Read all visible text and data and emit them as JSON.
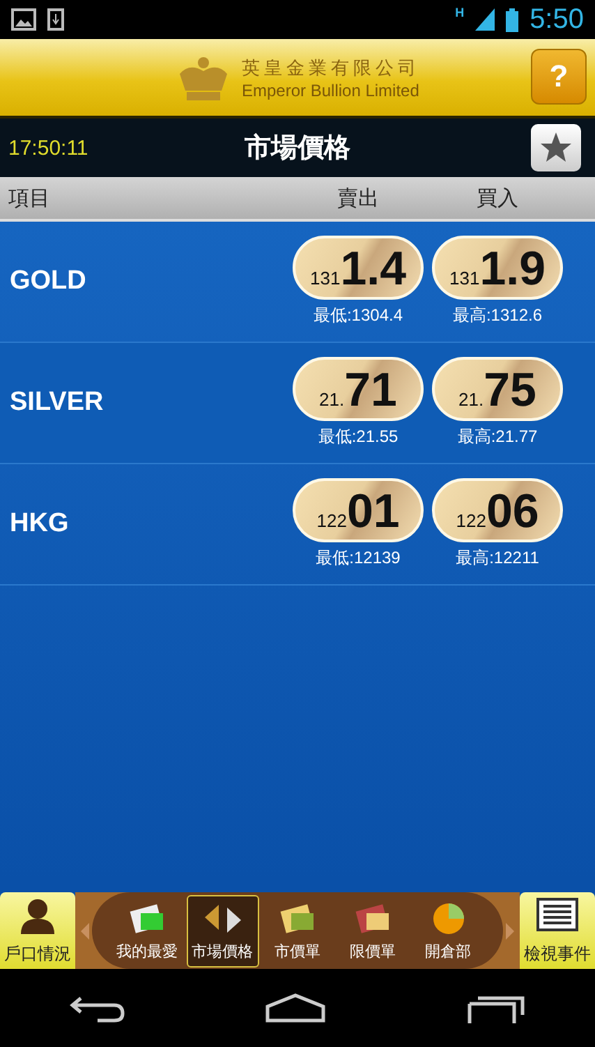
{
  "status_bar": {
    "network": "H",
    "time": "5:50"
  },
  "header": {
    "company_name": "英皇金業有限公司",
    "company_name_en": "Emperor Bullion Limited",
    "help_button": "?"
  },
  "title_bar": {
    "clock": "17:50:11",
    "title": "市場價格"
  },
  "columns": {
    "item": "項目",
    "sell": "賣出",
    "buy": "買入"
  },
  "rows": [
    {
      "name": "GOLD",
      "sell": {
        "prefix": "131",
        "main": "1.4",
        "note": "最低:1304.4"
      },
      "buy": {
        "prefix": "131",
        "main": "1.9",
        "note": "最高:1312.6"
      }
    },
    {
      "name": "SILVER",
      "sell": {
        "prefix": "21.",
        "main": "71",
        "note": "最低:21.55"
      },
      "buy": {
        "prefix": "21.",
        "main": "75",
        "note": "最高:21.77"
      }
    },
    {
      "name": "HKG",
      "sell": {
        "prefix": "122",
        "main": "01",
        "note": "最低:12139"
      },
      "buy": {
        "prefix": "122",
        "main": "06",
        "note": "最高:12211"
      }
    }
  ],
  "toolbar": {
    "left_button": "戶口情況",
    "right_button": "檢視事件",
    "tabs": [
      {
        "label": "我的最愛",
        "kind": "favorites",
        "selected": false
      },
      {
        "label": "市場價格",
        "kind": "prices",
        "selected": true
      },
      {
        "label": "市價單",
        "kind": "market",
        "selected": false
      },
      {
        "label": "限價單",
        "kind": "limit",
        "selected": false
      },
      {
        "label": "開倉部",
        "kind": "positions",
        "selected": false
      }
    ]
  }
}
